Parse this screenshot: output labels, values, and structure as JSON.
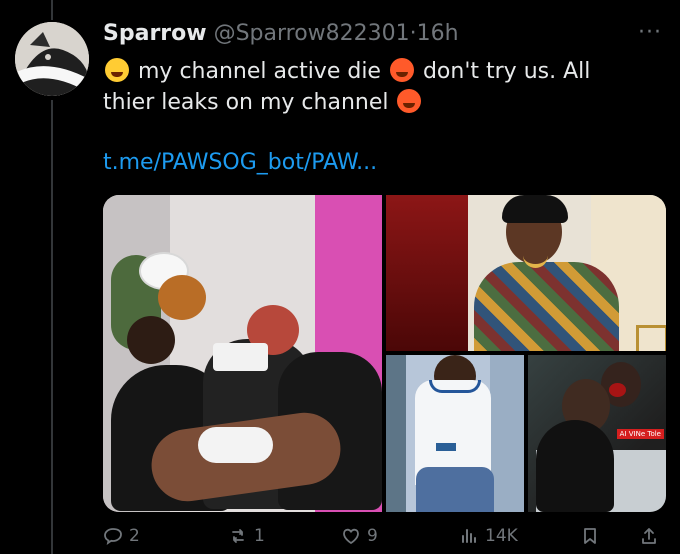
{
  "tweet": {
    "name": "Sparrow",
    "handle": "@Sparrow822301",
    "separator": "·",
    "time": "16h",
    "text_part1": "my channel active die",
    "text_part2": "don't try us. All",
    "text_part3": "thier leaks on my channel",
    "link": "t.me/PAWSOG_bot/PAW...",
    "more_label": "···"
  },
  "media": {
    "badge": "AI VINe\nTole"
  },
  "actions": {
    "replies": "2",
    "reposts": "1",
    "likes": "9",
    "views": "14K"
  },
  "icons": {
    "avatar": "cat-avatar",
    "emoji_joy": "face-with-tears-of-joy-emoji",
    "emoji_hot": "hot-face-emoji",
    "reply": "reply-icon",
    "repost": "repost-icon",
    "like": "like-icon",
    "views": "views-icon",
    "bookmark": "bookmark-icon",
    "share": "share-icon"
  },
  "colors": {
    "background": "#000000",
    "text": "#e7e9ea",
    "muted": "#71767b",
    "link": "#1d9bf0"
  }
}
